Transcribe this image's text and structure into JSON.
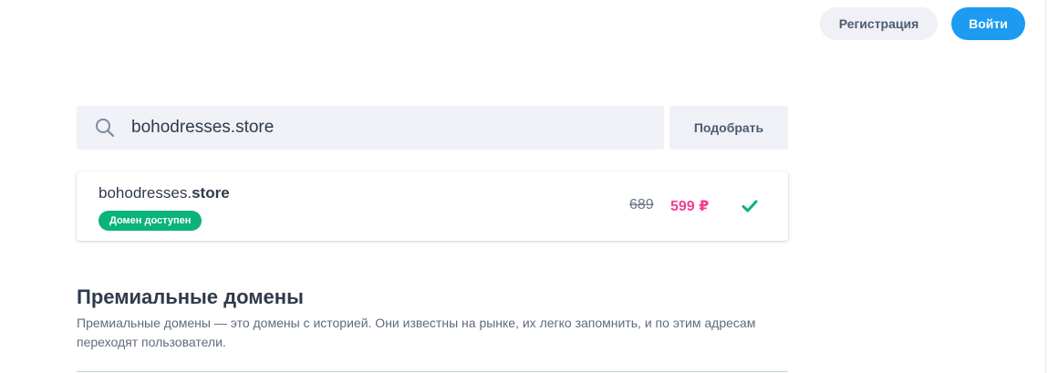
{
  "header": {
    "register_label": "Регистрация",
    "login_label": "Войти"
  },
  "search": {
    "value": "bohodresses.store",
    "pick_button_label": "Подобрать",
    "icon": "search-icon"
  },
  "result": {
    "domain_base": "bohodresses.",
    "domain_zone": "store",
    "status": "Домен доступен",
    "old_price": "689",
    "new_price": "599 ₽",
    "selected_icon": "check-icon"
  },
  "premium": {
    "title": "Премиальные домены",
    "description": "Премиальные домены — это домены с историей. Они известны на рынке, их легко запомнить, и по этим адресам переходят пользователи."
  },
  "colors": {
    "accent": "#1d9bf0",
    "badge_green": "#0bb37a",
    "price_pink": "#f03f94",
    "check_green": "#0bb37a",
    "panel_gray": "#f0f2f7"
  }
}
